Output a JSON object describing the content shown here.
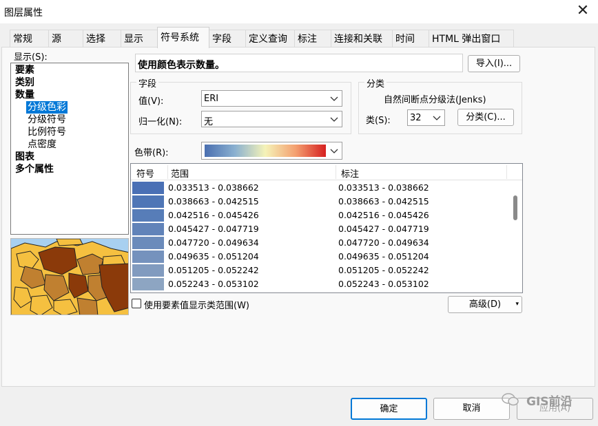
{
  "window": {
    "title": "图层属性",
    "close_glyph": "✕"
  },
  "tabs": [
    {
      "label": "常规"
    },
    {
      "label": "源"
    },
    {
      "label": "选择"
    },
    {
      "label": "显示"
    },
    {
      "label": "符号系统"
    },
    {
      "label": "字段"
    },
    {
      "label": "定义查询"
    },
    {
      "label": "标注"
    },
    {
      "label": "连接和关联"
    },
    {
      "label": "时间"
    },
    {
      "label": "HTML 弹出窗口"
    }
  ],
  "active_tab": "符号系统",
  "show": {
    "label": "显示(S):",
    "items": [
      "要素",
      "类别",
      "数量",
      "分级色彩",
      "分级符号",
      "比例符号",
      "点密度",
      "图表",
      "多个属性"
    ],
    "selected": "分级色彩"
  },
  "description": "使用颜色表示数量。",
  "import_button": "导入(I)...",
  "fields": {
    "group_title": "字段",
    "value_label": "值(V):",
    "value": "ERI",
    "normalization_label": "归一化(N):",
    "normalization": "无"
  },
  "classification": {
    "group_title": "分类",
    "method": "自然间断点分级法(Jenks)",
    "classes_label": "类(S):",
    "classes": "32",
    "classify_button": "分类(C)..."
  },
  "color_ramp": {
    "label": "色带(R):",
    "stops": [
      "#4a6fb0",
      "#8ab0d0",
      "#f5f3b8",
      "#f4a070",
      "#d62020"
    ]
  },
  "table": {
    "headers": [
      "符号",
      "范围",
      "标注"
    ],
    "rows": [
      {
        "color": "#4a70b5",
        "range": "0.033513 - 0.038662",
        "label": "0.033513 - 0.038662"
      },
      {
        "color": "#4f76b6",
        "range": "0.038663 - 0.042515",
        "label": "0.038663 - 0.042515"
      },
      {
        "color": "#577db8",
        "range": "0.042516 - 0.045426",
        "label": "0.042516 - 0.045426"
      },
      {
        "color": "#6183b9",
        "range": "0.045427 - 0.047719",
        "label": "0.045427 - 0.047719"
      },
      {
        "color": "#6b8bbb",
        "range": "0.047720 - 0.049634",
        "label": "0.047720 - 0.049634"
      },
      {
        "color": "#7592bd",
        "range": "0.049635 - 0.051204",
        "label": "0.049635 - 0.051204"
      },
      {
        "color": "#819bbf",
        "range": "0.051205 - 0.052242",
        "label": "0.051205 - 0.052242"
      },
      {
        "color": "#8da5c2",
        "range": "0.052243 - 0.053102",
        "label": "0.052243 - 0.053102"
      }
    ]
  },
  "show_class_ranges": "使用要素值显示类范围(W)",
  "advanced_button": "高级(D)",
  "footer": {
    "ok": "确定",
    "cancel": "取消",
    "apply": "应用(A)"
  },
  "watermark": "GIS前沿",
  "colors": {
    "selection": "#0078d7",
    "accent_border": "#0078d7",
    "map_water": "#a8d0f0",
    "map_dark": "#8b3a0a",
    "map_mid": "#c08030",
    "map_light": "#f5c040"
  }
}
